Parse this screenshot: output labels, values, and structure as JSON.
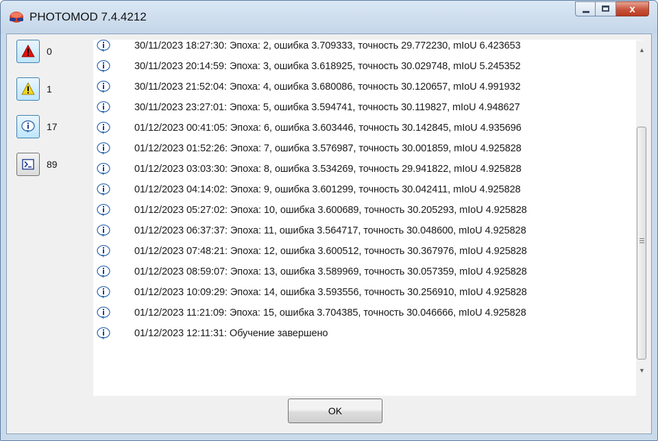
{
  "window": {
    "title": "PHOTOMOD 7.4.4212",
    "close_glyph": "x",
    "accent_titlebar": "#c9daea",
    "close_color": "#c7533b"
  },
  "filters": [
    {
      "icon": "error-icon",
      "count": "0",
      "color": "#e01010",
      "pressed": true
    },
    {
      "icon": "warning-icon",
      "count": "1",
      "color": "#f2d51c",
      "pressed": true
    },
    {
      "icon": "info-icon",
      "count": "17",
      "color": "#3a6fb0",
      "pressed": true
    },
    {
      "icon": "console-icon",
      "count": "89",
      "color": "#1f3c8f",
      "pressed": false
    }
  ],
  "log": {
    "entries": [
      "30/11/2023 18:27:30: Эпоха: 2, ошибка 3.709333, точность 29.772230, mIoU 6.423653",
      "30/11/2023 20:14:59: Эпоха: 3, ошибка 3.618925, точность 30.029748, mIoU 5.245352",
      "30/11/2023 21:52:04: Эпоха: 4, ошибка 3.680086, точность 30.120657, mIoU 4.991932",
      "30/11/2023 23:27:01: Эпоха: 5, ошибка 3.594741, точность 30.119827, mIoU 4.948627",
      "01/12/2023 00:41:05: Эпоха: 6, ошибка 3.603446, точность 30.142845, mIoU 4.935696",
      "01/12/2023 01:52:26: Эпоха: 7, ошибка 3.576987, точность 30.001859, mIoU 4.925828",
      "01/12/2023 03:03:30: Эпоха: 8, ошибка 3.534269, точность 29.941822, mIoU 4.925828",
      "01/12/2023 04:14:02: Эпоха: 9, ошибка 3.601299, точность 30.042411, mIoU 4.925828",
      "01/12/2023 05:27:02: Эпоха: 10, ошибка 3.600689, точность 30.205293, mIoU 4.925828",
      "01/12/2023 06:37:37: Эпоха: 11, ошибка 3.564717, точность 30.048600, mIoU 4.925828",
      "01/12/2023 07:48:21: Эпоха: 12, ошибка 3.600512, точность 30.367976, mIoU 4.925828",
      "01/12/2023 08:59:07: Эпоха: 13, ошибка 3.589969, точность 30.057359, mIoU 4.925828",
      "01/12/2023 10:09:29: Эпоха: 14, ошибка 3.593556, точность 30.256910, mIoU 4.925828",
      "01/12/2023 11:21:09: Эпоха: 15, ошибка 3.704385, точность 30.046666, mIoU 4.925828",
      "01/12/2023 12:11:31: Обучение завершено"
    ],
    "entry_icon": "info-icon"
  },
  "scrollbar": {
    "up_glyph": "▲",
    "down_glyph": "▼"
  },
  "ok_label": "OK"
}
